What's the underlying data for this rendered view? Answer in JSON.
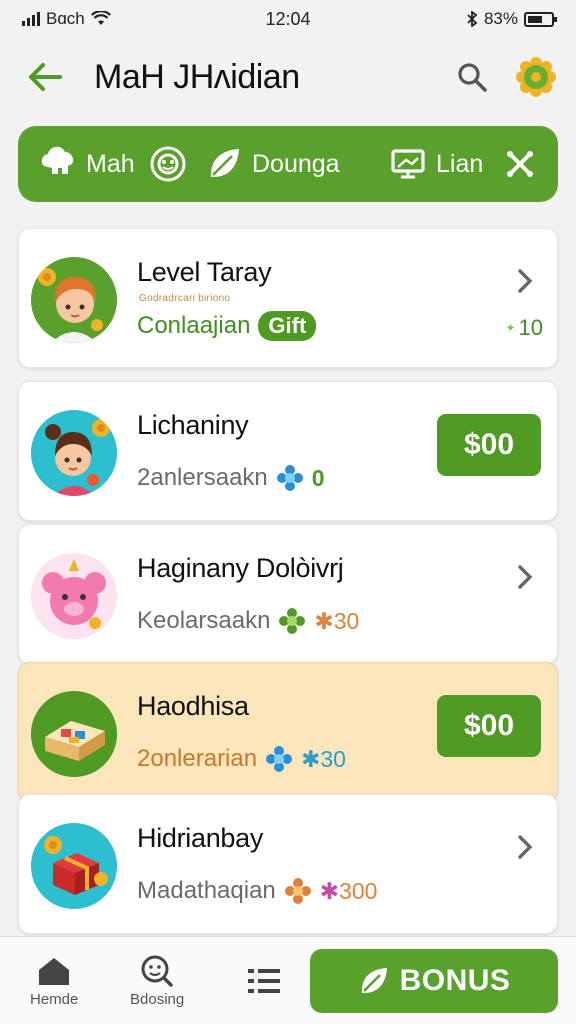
{
  "status_bar": {
    "carrier": "Bɑch",
    "time": "12:04",
    "battery": "83%"
  },
  "header": {
    "title": "MaH JHʌidian",
    "back_icon": "arrow-left-icon",
    "search_icon": "search-icon",
    "settings_icon": "gear-icon"
  },
  "tabs": [
    {
      "label": "Mah",
      "icon": "chef-hat-icon"
    },
    {
      "label": "",
      "icon": "face-circle-icon"
    },
    {
      "label": "Dounga",
      "icon": "leaf-icon"
    },
    {
      "label": "Lian",
      "icon": "monitor-icon"
    }
  ],
  "tabbar_close_icon": "close-icon",
  "cards": [
    {
      "title": "Level Taray",
      "tiny": "Godradrcari biriono",
      "sub": "Conlaajian",
      "pill": "Gift",
      "right": "10",
      "action": "chevron"
    },
    {
      "title": "Lichaniny",
      "sub": "2anlersaakn",
      "badge": "0",
      "price": "$00",
      "action": "price"
    },
    {
      "title": "Haginany Dolòivrj",
      "sub": "Keolarsaakn",
      "badge": "30",
      "action": "chevron"
    },
    {
      "title": "Haodhisa",
      "sub": "2onlerarian",
      "badge": "30",
      "price": "$00",
      "action": "price",
      "highlighted": true
    },
    {
      "title": "Hidrianbay",
      "sub": "Madathaqian",
      "badge": "300",
      "action": "chevron"
    }
  ],
  "bottom_nav": [
    {
      "label": "Hemde",
      "icon": "home-icon"
    },
    {
      "label": "Bdosing",
      "icon": "search-emoji-icon"
    },
    {
      "label": "",
      "icon": "list-icon"
    }
  ],
  "bonus_button": {
    "label": "BONUS",
    "icon": "leaf-icon"
  },
  "colors": {
    "primary": "#5aa02c",
    "highlight": "#fbe6bb"
  }
}
